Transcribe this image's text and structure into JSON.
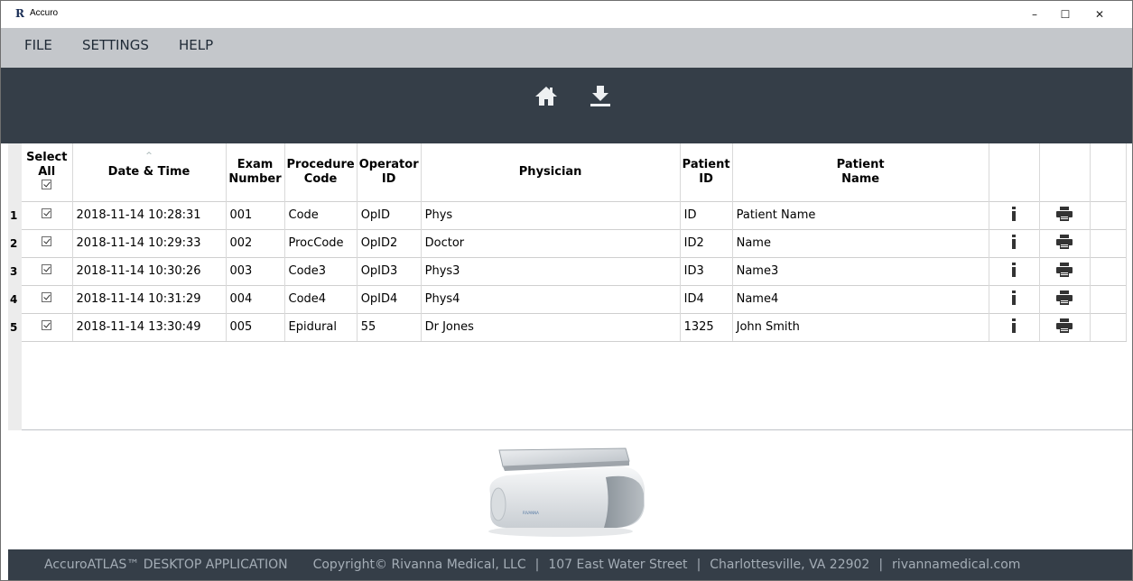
{
  "window": {
    "logo": "R",
    "title": "Accuro",
    "minimize": "–",
    "maximize": "☐",
    "close": "✕"
  },
  "menu": {
    "file": "FILE",
    "settings": "SETTINGS",
    "help": "HELP"
  },
  "toolbar": {
    "icons": [
      "home-icon",
      "download-icon"
    ],
    "icon_color": "#eef0f2"
  },
  "table": {
    "headers": {
      "select_all": [
        "Select",
        "All"
      ],
      "date_time": "Date & Time",
      "exam_number": [
        "Exam",
        "Number"
      ],
      "procedure_code": [
        "Procedure",
        "Code"
      ],
      "operator_id": [
        "Operator",
        "ID"
      ],
      "physician": "Physician",
      "patient_id": [
        "Patient",
        "ID"
      ],
      "patient_name": [
        "Patient",
        "Name"
      ]
    },
    "sort_indicator": "^",
    "rows": [
      {
        "num": "1",
        "date": "2018-11-14 10:28:31",
        "exam": "001",
        "proc": "Code",
        "op": "OpID",
        "phys": "Phys",
        "pid": "ID",
        "pname": "Patient Name"
      },
      {
        "num": "2",
        "date": "2018-11-14 10:29:33",
        "exam": "002",
        "proc": "ProcCode",
        "op": "OpID2",
        "phys": "Doctor",
        "pid": "ID2",
        "pname": "Name"
      },
      {
        "num": "3",
        "date": "2018-11-14 10:30:26",
        "exam": "003",
        "proc": "Code3",
        "op": "OpID3",
        "phys": "Phys3",
        "pid": "ID3",
        "pname": "Name3"
      },
      {
        "num": "4",
        "date": "2018-11-14 10:31:29",
        "exam": "004",
        "proc": "Code4",
        "op": "OpID4",
        "phys": "Phys4",
        "pid": "ID4",
        "pname": "Name4"
      },
      {
        "num": "5",
        "date": "2018-11-14 13:30:49",
        "exam": "005",
        "proc": "Epidural",
        "op": "55",
        "phys": "Dr Jones",
        "pid": "1325",
        "pname": "John Smith"
      }
    ]
  },
  "device": {
    "brand_text": "RIVANNA"
  },
  "footer": {
    "app": "AccuroATLAS™ DESKTOP APPLICATION",
    "copyright": "Copyright© Rivanna Medical, LLC",
    "address": "107 East Water Street",
    "city": "Charlottesville, VA 22902",
    "website": "rivannamedical.com",
    "separator": "|"
  },
  "colors": {
    "toolbar_bg": "#353e48",
    "menubar_bg": "#c4c7cb",
    "footer_text": "#a4adb6"
  }
}
